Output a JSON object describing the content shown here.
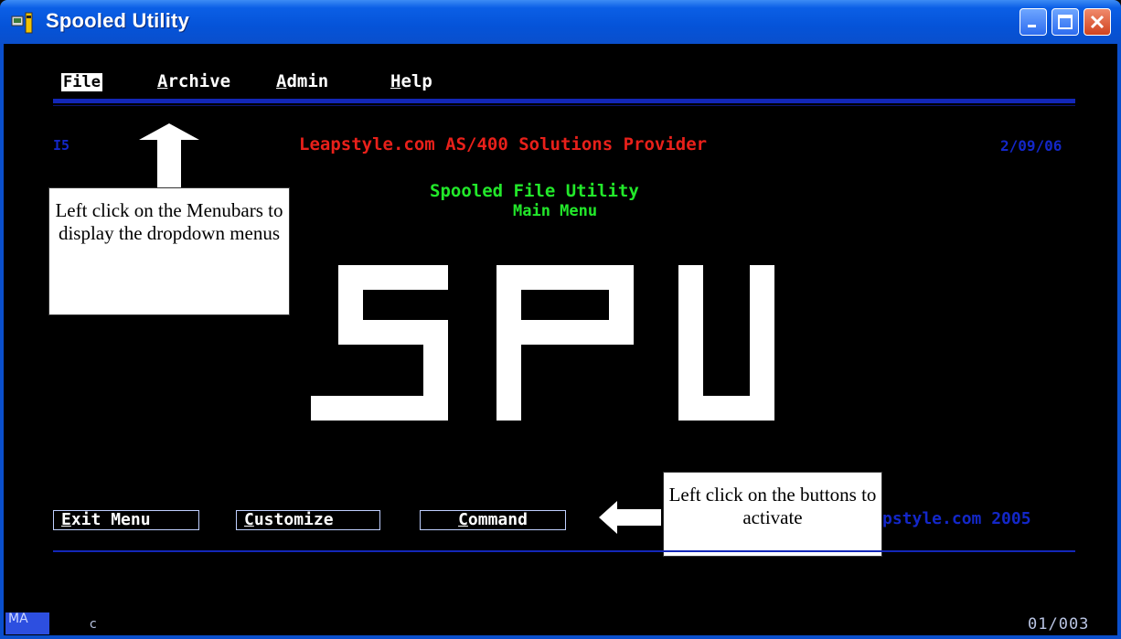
{
  "window": {
    "title": "Spooled Utility",
    "colors": {
      "titlebar": "#0553d8",
      "screen": "#000000"
    }
  },
  "menubar": {
    "items": [
      {
        "label": "File",
        "selected": true
      },
      {
        "label": "Archive"
      },
      {
        "label": "Admin"
      },
      {
        "label": "Help"
      }
    ]
  },
  "header": {
    "system": "I5",
    "company": "Leapstyle.com AS/400 Solutions Provider",
    "date": "2/09/06"
  },
  "main": {
    "title": "Spooled File Utility",
    "subtitle": "Main Menu",
    "logo_text": "SPU"
  },
  "callouts": {
    "menubar_hint": "Left click on the Menubars to display the dropdown menus",
    "buttons_hint": "Left click on the buttons to activate"
  },
  "buttons": {
    "exit": "Exit Menu",
    "customize": "Customize",
    "command": "Command"
  },
  "footer": {
    "brand": "pstyle.com 2005"
  },
  "statusbar": {
    "mode": "MA",
    "indicator": "c",
    "cursor_position": "01/003"
  }
}
